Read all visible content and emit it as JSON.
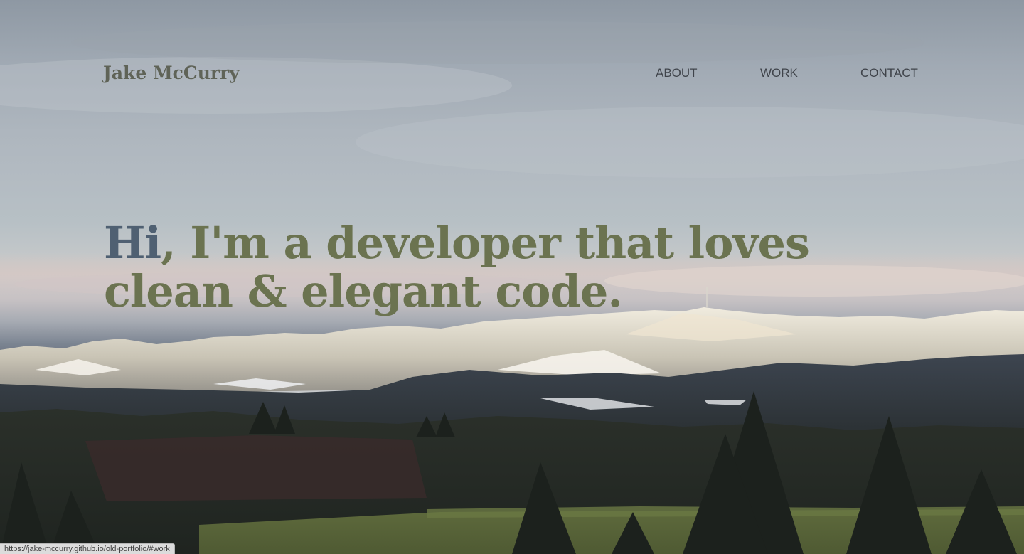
{
  "header": {
    "brand": "Jake McCurry",
    "nav": [
      {
        "label": "ABOUT"
      },
      {
        "label": "WORK"
      },
      {
        "label": "CONTACT"
      }
    ]
  },
  "hero": {
    "headline_highlight": "Hi",
    "headline_rest_line1": ", I'm a developer that loves",
    "headline_line2": "clean & elegant code.",
    "background_image": "snowy-mountain-landscape"
  },
  "status_bar": {
    "url": "https://jake-mccurry.github.io/old-portfolio/#work"
  },
  "colors": {
    "brand": "#5f6357",
    "headline": "#6b7350",
    "headline_highlight": "#4f6072",
    "nav_link": "#3f434a"
  }
}
